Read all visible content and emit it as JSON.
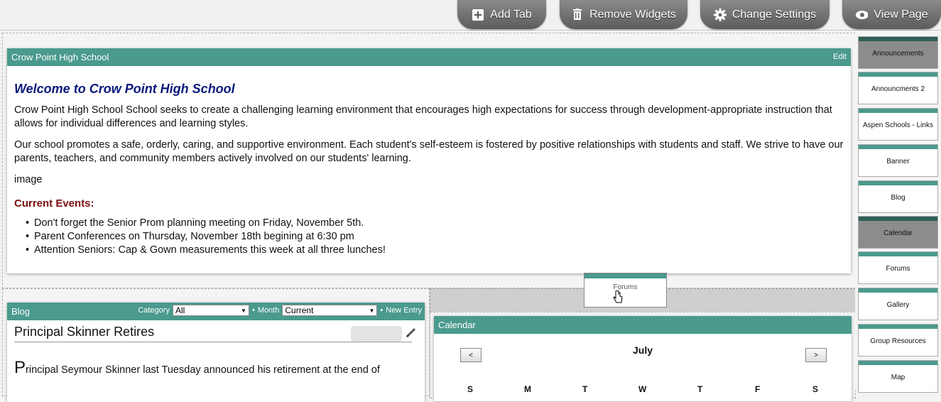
{
  "toolbar": {
    "add_tab": "Add Tab",
    "remove_widgets": "Remove Widgets",
    "change_settings": "Change Settings",
    "view_page": "View Page"
  },
  "main_widget": {
    "title": "Crow Point High School",
    "edit": "Edit",
    "heading": "Welcome to Crow Point High School",
    "para1": "Crow Point High School School seeks to create a challenging learning environment that encourages high expectations for success through development-appropriate instruction that allows for individual differences and learning styles.",
    "para2": "Our school promotes a safe, orderly, caring, and supportive environment. Each student's self-esteem is fostered by positive relationships with students and staff. We strive to have our parents, teachers, and community members actively involved on our students' learning.",
    "image_text": "image",
    "events_heading": "Current Events:",
    "events": [
      "Don't forget the Senior Prom planning meeting on Friday, November 5th.",
      "Parent Conferences on Thursday, November 18th begining at 6:30 pm",
      "Attention Seniors: Cap & Gown measurements this week at all three lunches!"
    ]
  },
  "blog": {
    "title": "Blog",
    "category_label": "Category",
    "category_value": "All",
    "month_label": "Month",
    "month_value": "Current",
    "new_entry": "New Entry",
    "post_title": "Principal Skinner Retires",
    "post_dropcap": "P",
    "post_text": "rincipal Seymour Skinner last Tuesday announced his retirement at the end of"
  },
  "calendar": {
    "title": "Calendar",
    "month": "July",
    "prev": "<",
    "next": ">",
    "days": [
      "S",
      "M",
      "T",
      "W",
      "T",
      "F",
      "S"
    ]
  },
  "drag_ghost": {
    "label": "Forums"
  },
  "side_widgets": [
    {
      "label": "Announcements",
      "state": "dimmed"
    },
    {
      "label": "Announcments 2",
      "state": "normal"
    },
    {
      "label": "Aspen Schools - Links",
      "state": "normal"
    },
    {
      "label": "Banner",
      "state": "normal"
    },
    {
      "label": "Blog",
      "state": "normal"
    },
    {
      "label": "Calendar",
      "state": "dimmed"
    },
    {
      "label": "Forums",
      "state": "normal"
    },
    {
      "label": "Gallery",
      "state": "normal"
    },
    {
      "label": "Group Resources",
      "state": "normal"
    },
    {
      "label": "Map",
      "state": "normal"
    }
  ],
  "colors": {
    "header": "#4a9a8d",
    "heading": "#0b1a78",
    "events": "#7a1010"
  }
}
